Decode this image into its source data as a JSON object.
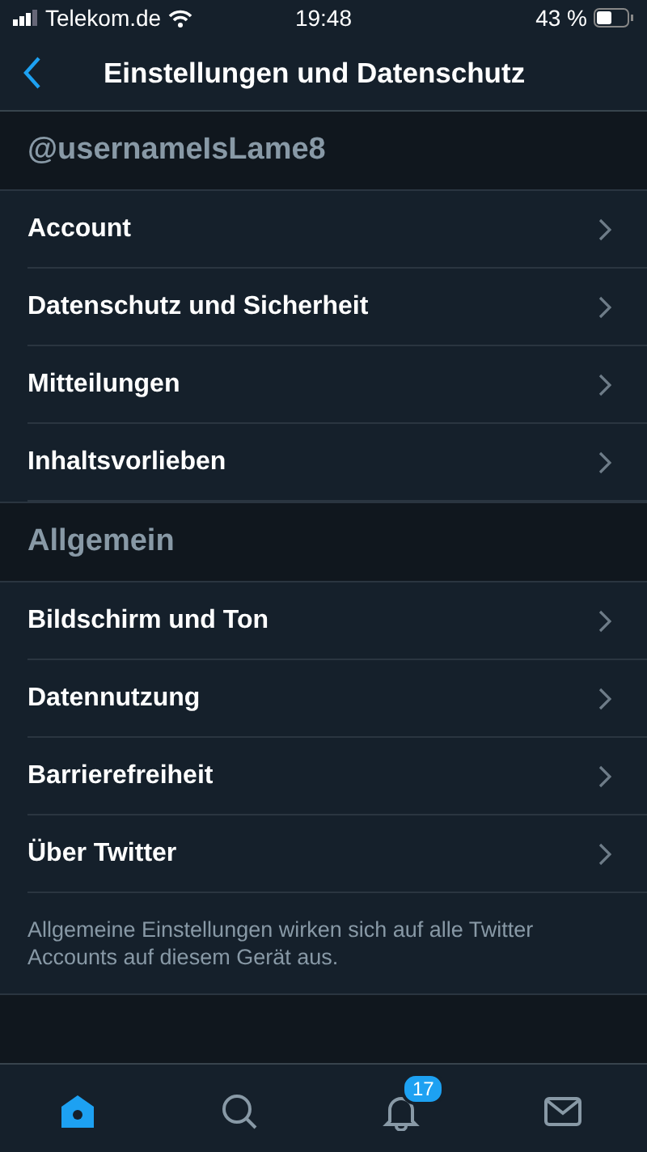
{
  "status_bar": {
    "carrier": "Telekom.de",
    "time": "19:48",
    "battery": "43 %"
  },
  "nav": {
    "title": "Einstellungen und Datenschutz"
  },
  "sections": [
    {
      "header": "@usernameIsLame8",
      "items": [
        "Account",
        "Datenschutz und Sicherheit",
        "Mitteilungen",
        "Inhaltsvorlieben"
      ]
    },
    {
      "header": "Allgemein",
      "items": [
        "Bildschirm und Ton",
        "Datennutzung",
        "Barrierefreiheit",
        "Über Twitter"
      ],
      "note": "Allgemeine Einstellungen wirken sich auf alle Twitter Accounts auf diesem Gerät aus."
    }
  ],
  "tabs": [
    {
      "kind": "home",
      "selected": true
    },
    {
      "kind": "search",
      "selected": false
    },
    {
      "kind": "notifications",
      "selected": false,
      "badge": "17"
    },
    {
      "kind": "messages",
      "selected": false
    }
  ]
}
